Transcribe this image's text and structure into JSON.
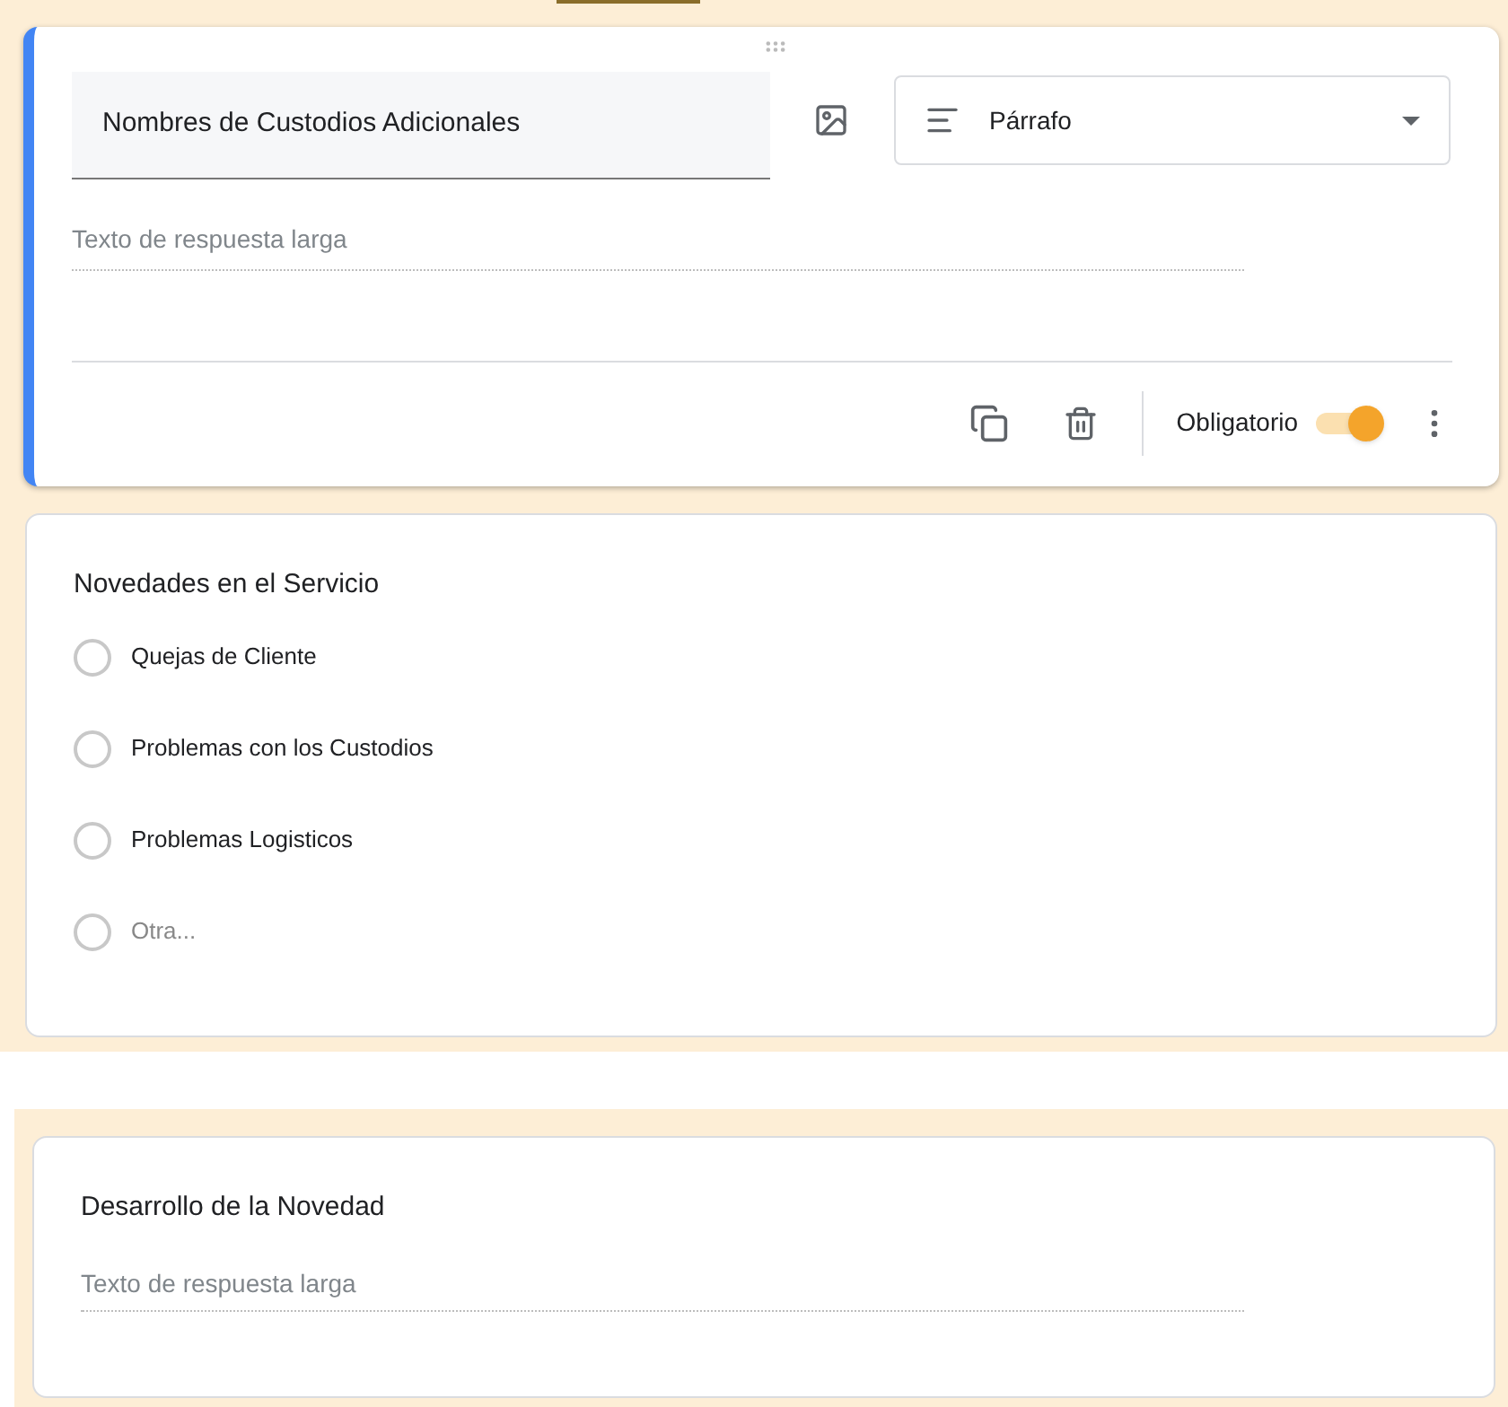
{
  "active_question": {
    "title": "Nombres de Custodios Adicionales",
    "type_label": "Párrafo",
    "answer_placeholder": "Texto de respuesta larga",
    "required_label": "Obligatorio",
    "required": true
  },
  "choice_question": {
    "title": "Novedades en el Servicio",
    "options": [
      {
        "label": "Quejas de Cliente",
        "kind": "option",
        "selected": false
      },
      {
        "label": "Problemas con los Custodios",
        "kind": "option",
        "selected": false
      },
      {
        "label": "Problemas Logisticos",
        "kind": "option",
        "selected": false
      },
      {
        "label": "Otra...",
        "kind": "other",
        "selected": false
      }
    ]
  },
  "text_question": {
    "title": "Desarrollo de la Novedad",
    "answer_placeholder": "Texto de respuesta larga"
  }
}
